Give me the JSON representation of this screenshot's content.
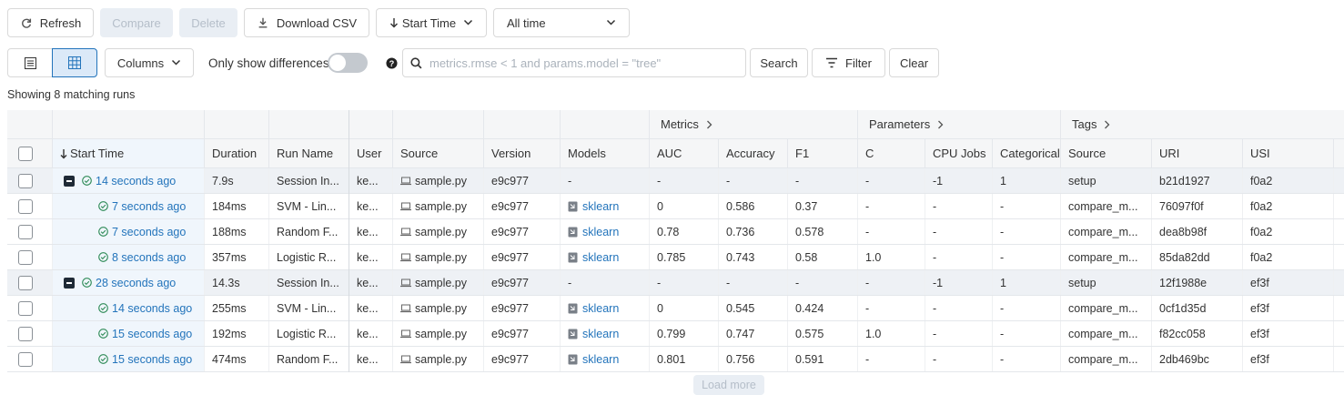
{
  "toolbar": {
    "refresh_label": "Refresh",
    "compare_label": "Compare",
    "delete_label": "Delete",
    "download_label": "Download CSV",
    "sort_label": "Start Time",
    "time_filter_value": "All time"
  },
  "controls": {
    "columns_label": "Columns",
    "only_diff_label": "Only show differences",
    "search_placeholder": "metrics.rmse < 1 and params.model = \"tree\"",
    "search_label": "Search",
    "filter_label": "Filter",
    "clear_label": "Clear"
  },
  "status_text": "Showing 8 matching runs",
  "groups": {
    "metrics": "Metrics",
    "parameters": "Parameters",
    "tags": "Tags"
  },
  "columns": [
    "Start Time",
    "Duration",
    "Run Name",
    "User",
    "Source",
    "Version",
    "Models",
    "AUC",
    "Accuracy",
    "F1",
    "C",
    "CPU Jobs",
    "Categorical",
    "Source",
    "URI",
    "USI"
  ],
  "rows": [
    {
      "parent": true,
      "start": "14 seconds ago",
      "duration": "7.9s",
      "name": "Session In...",
      "user": "ke...",
      "source": "sample.py",
      "version": "e9c977",
      "model": "-",
      "auc": "-",
      "acc": "-",
      "f1": "-",
      "c": "-",
      "cpu": "-1",
      "cat": "1",
      "tsource": "setup",
      "uri": "b21d1927",
      "usi": "f0a2"
    },
    {
      "parent": false,
      "start": "7 seconds ago",
      "duration": "184ms",
      "name": "SVM - Lin...",
      "user": "ke...",
      "source": "sample.py",
      "version": "e9c977",
      "model": "sklearn",
      "auc": "0",
      "acc": "0.586",
      "f1": "0.37",
      "c": "-",
      "cpu": "-",
      "cat": "-",
      "tsource": "compare_m...",
      "uri": "76097f0f",
      "usi": "f0a2"
    },
    {
      "parent": false,
      "start": "7 seconds ago",
      "duration": "188ms",
      "name": "Random F...",
      "user": "ke...",
      "source": "sample.py",
      "version": "e9c977",
      "model": "sklearn",
      "auc": "0.78",
      "acc": "0.736",
      "f1": "0.578",
      "c": "-",
      "cpu": "-",
      "cat": "-",
      "tsource": "compare_m...",
      "uri": "dea8b98f",
      "usi": "f0a2"
    },
    {
      "parent": false,
      "start": "8 seconds ago",
      "duration": "357ms",
      "name": "Logistic R...",
      "user": "ke...",
      "source": "sample.py",
      "version": "e9c977",
      "model": "sklearn",
      "auc": "0.785",
      "acc": "0.743",
      "f1": "0.58",
      "c": "1.0",
      "cpu": "-",
      "cat": "-",
      "tsource": "compare_m...",
      "uri": "85da82dd",
      "usi": "f0a2"
    },
    {
      "parent": true,
      "start": "28 seconds ago",
      "duration": "14.3s",
      "name": "Session In...",
      "user": "ke...",
      "source": "sample.py",
      "version": "e9c977",
      "model": "-",
      "auc": "-",
      "acc": "-",
      "f1": "-",
      "c": "-",
      "cpu": "-1",
      "cat": "1",
      "tsource": "setup",
      "uri": "12f1988e",
      "usi": "ef3f"
    },
    {
      "parent": false,
      "start": "14 seconds ago",
      "duration": "255ms",
      "name": "SVM - Lin...",
      "user": "ke...",
      "source": "sample.py",
      "version": "e9c977",
      "model": "sklearn",
      "auc": "0",
      "acc": "0.545",
      "f1": "0.424",
      "c": "-",
      "cpu": "-",
      "cat": "-",
      "tsource": "compare_m...",
      "uri": "0cf1d35d",
      "usi": "ef3f"
    },
    {
      "parent": false,
      "start": "15 seconds ago",
      "duration": "192ms",
      "name": "Logistic R...",
      "user": "ke...",
      "source": "sample.py",
      "version": "e9c977",
      "model": "sklearn",
      "auc": "0.799",
      "acc": "0.747",
      "f1": "0.575",
      "c": "1.0",
      "cpu": "-",
      "cat": "-",
      "tsource": "compare_m...",
      "uri": "f82cc058",
      "usi": "ef3f"
    },
    {
      "parent": false,
      "start": "15 seconds ago",
      "duration": "474ms",
      "name": "Random F...",
      "user": "ke...",
      "source": "sample.py",
      "version": "e9c977",
      "model": "sklearn",
      "auc": "0.801",
      "acc": "0.756",
      "f1": "0.591",
      "c": "-",
      "cpu": "-",
      "cat": "-",
      "tsource": "compare_m...",
      "uri": "2db469bc",
      "usi": "ef3f"
    }
  ],
  "load_more_label": "Load more",
  "colors": {
    "accent": "#2374bb",
    "success": "#2e8b57"
  }
}
